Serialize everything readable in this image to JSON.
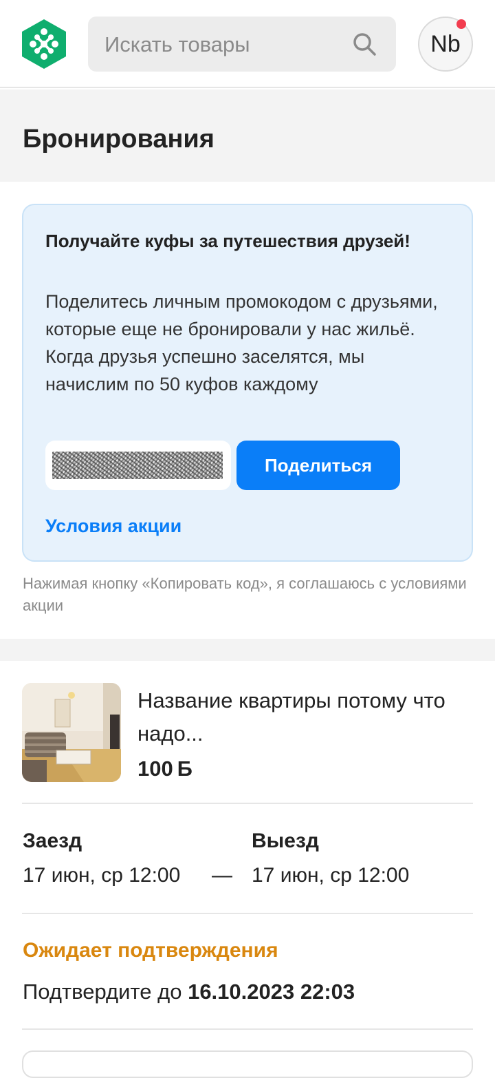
{
  "header": {
    "search": {
      "placeholder": "Искать товары"
    },
    "avatar": {
      "initials": "Nb"
    },
    "colors": {
      "brand": "#0fae6e",
      "notification": "#f23d4f"
    }
  },
  "page": {
    "title": "Бронирования"
  },
  "promo": {
    "title": "Получайте куфы за путешествия друзей!",
    "text": "Поделитесь личным промокодом с друзьями, которые еще не бронировали у нас жильё. Когда друзья успешно заселятся, мы начислим по 50 куфов каждому",
    "share_label": "Поделиться",
    "terms_link": "Условия акции",
    "disclaimer": "Нажимая кнопку «Копировать код», я соглашаюсь с условиями акции",
    "colors": {
      "accent": "#0a7ef8",
      "background": "#e7f2fc"
    }
  },
  "booking": {
    "name": "Название квартиры потому что надо...",
    "price": "100",
    "currency": "Ƃ",
    "checkin": {
      "label": "Заезд",
      "value": "17 июн, ср 12:00"
    },
    "separator": "—",
    "checkout": {
      "label": "Выезд",
      "value": "17 июн, ср 12:00"
    },
    "status": "Ожидает подтверждения",
    "status_color": "#d9870f",
    "confirm_prefix": "Подтвердите до ",
    "confirm_deadline": "16.10.2023 22:03"
  }
}
